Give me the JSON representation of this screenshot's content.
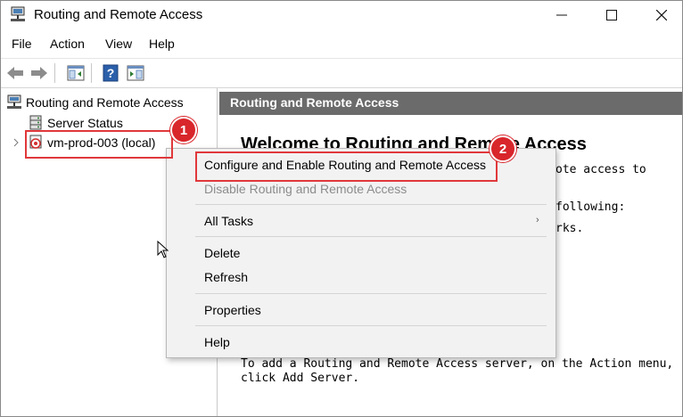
{
  "window": {
    "title": "Routing and Remote Access",
    "icon": "rras-app-icon"
  },
  "menu": [
    "File",
    "Action",
    "View",
    "Help"
  ],
  "toolbar": {
    "buttons": [
      "back-arrow-icon",
      "forward-arrow-icon",
      "show-hide-console-tree-icon",
      "help-icon",
      "show-hide-action-pane-icon"
    ]
  },
  "tree": {
    "root": "Routing and Remote Access",
    "server_status": "Server Status",
    "server": "vm-prod-003 (local)"
  },
  "details": {
    "header": "Routing and Remote Access",
    "welcome": "Welcome to Routing and Remote Access",
    "line1": "ote access to",
    "line2": "following:",
    "line3": "rks.",
    "bottom1": "To add a Routing and Remote Access server, on the Action menu,",
    "bottom2": "click Add Server."
  },
  "context_menu": {
    "configure": "Configure and Enable Routing and Remote Access",
    "disable": "Disable Routing and Remote Access",
    "all_tasks": "All Tasks",
    "delete": "Delete",
    "refresh": "Refresh",
    "properties": "Properties",
    "help": "Help"
  },
  "callouts": {
    "badge1": "1",
    "badge2": "2",
    "color": "#d8262b"
  }
}
